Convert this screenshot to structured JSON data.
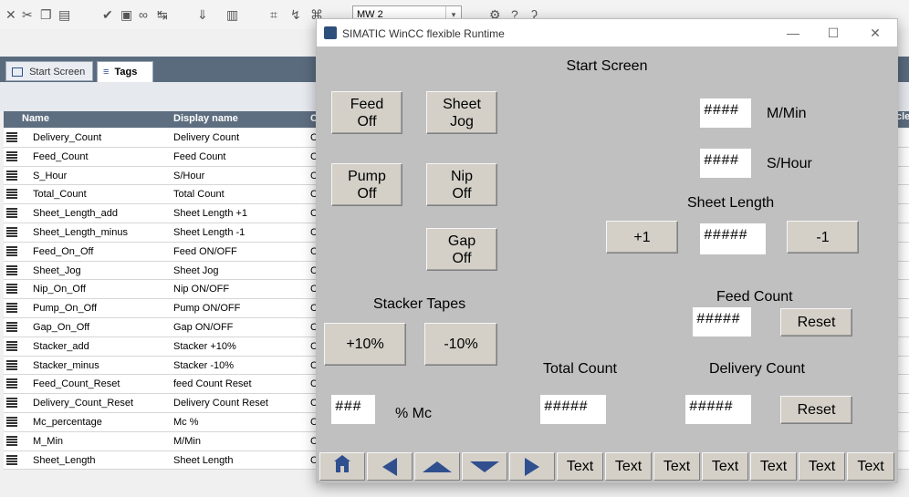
{
  "toolbar": {
    "combo_value": "MW 2"
  },
  "tabs": [
    {
      "label": "Start Screen"
    },
    {
      "label": "Tags"
    }
  ],
  "tag_table": {
    "headers": {
      "name": "Name",
      "display_name": "Display name",
      "col3": "C",
      "col_right": "cle"
    },
    "rows": [
      {
        "name": "Delivery_Count",
        "display": "Delivery Count",
        "c": "C"
      },
      {
        "name": "Feed_Count",
        "display": "Feed Count",
        "c": "C"
      },
      {
        "name": "S_Hour",
        "display": "S/Hour",
        "c": "C"
      },
      {
        "name": "Total_Count",
        "display": "Total Count",
        "c": "C"
      },
      {
        "name": "Sheet_Length_add",
        "display": "Sheet Length +1",
        "c": "C"
      },
      {
        "name": "Sheet_Length_minus",
        "display": "Sheet Length -1",
        "c": "C"
      },
      {
        "name": "Feed_On_Off",
        "display": "Feed ON/OFF",
        "c": "C"
      },
      {
        "name": "Sheet_Jog",
        "display": "Sheet Jog",
        "c": "C"
      },
      {
        "name": "Nip_On_Off",
        "display": "Nip ON/OFF",
        "c": "C"
      },
      {
        "name": "Pump_On_Off",
        "display": "Pump ON/OFF",
        "c": "C"
      },
      {
        "name": "Gap_On_Off",
        "display": "Gap ON/OFF",
        "c": "C"
      },
      {
        "name": "Stacker_add",
        "display": "Stacker +10%",
        "c": "C"
      },
      {
        "name": "Stacker_minus",
        "display": "Stacker -10%",
        "c": "C"
      },
      {
        "name": "Feed_Count_Reset",
        "display": "feed Count Reset",
        "c": "C"
      },
      {
        "name": "Delivery_Count_Reset",
        "display": "Delivery Count Reset",
        "c": "C"
      },
      {
        "name": "Mc_percentage",
        "display": "Mc %",
        "c": "C"
      },
      {
        "name": "M_Min",
        "display": "M/Min",
        "c": "C"
      },
      {
        "name": "Sheet_Length",
        "display": "Sheet Length",
        "c": "C"
      }
    ]
  },
  "runtime": {
    "window_title": "SIMATIC WinCC flexible Runtime",
    "screen_title": "Start Screen",
    "buttons": {
      "feed": "Feed\nOff",
      "sheet_jog": "Sheet\nJog",
      "pump": "Pump\nOff",
      "nip": "Nip\nOff",
      "gap": "Gap\nOff",
      "plus1": "+1",
      "minus1": "-1",
      "stacker_plus": "+10%",
      "stacker_minus": "-10%",
      "feed_reset": "Reset",
      "delivery_reset": "Reset"
    },
    "labels": {
      "m_min": "M/Min",
      "s_hour": "S/Hour",
      "sheet_length": "Sheet Length",
      "feed_count": "Feed Count",
      "stacker_tapes": "Stacker Tapes",
      "total_count": "Total Count",
      "delivery_count": "Delivery Count",
      "mc": "% Mc"
    },
    "fields": {
      "m_min": "####",
      "s_hour": "####",
      "sheet_length": "#####",
      "feed_count": "#####",
      "mc": "###",
      "total_count": "#####",
      "delivery_count": "#####"
    },
    "nav_text_buttons": [
      "Text",
      "Text",
      "Text",
      "Text",
      "Text",
      "Text",
      "Text"
    ]
  }
}
